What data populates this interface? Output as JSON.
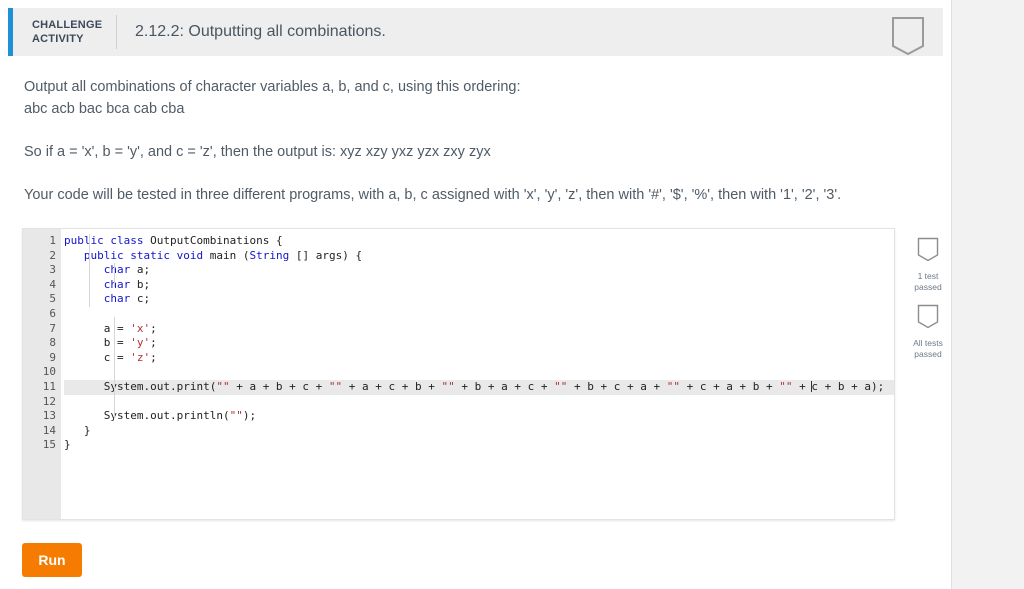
{
  "header": {
    "kicker_line1": "CHALLENGE",
    "kicker_line2": "ACTIVITY",
    "title": "2.12.2: Outputting all combinations.",
    "bookmark_icon": "shield-bookmark-icon"
  },
  "prompt": {
    "line1": "Output all combinations of character variables a, b, and c, using this ordering:",
    "line2": "abc acb bac bca cab cba",
    "line3": "So if a = 'x', b = 'y', and c = 'z', then the output is: xyz xzy yxz yzx zxy zyx",
    "line4": "Your code will be tested in three different programs, with a, b, c assigned with 'x', 'y', 'z', then with '#', '$', '%', then with '1', '2', '3'."
  },
  "editor": {
    "line_numbers": [
      "1",
      "2",
      "3",
      "4",
      "5",
      "6",
      "7",
      "8",
      "9",
      "10",
      "11",
      "12",
      "13",
      "14",
      "15"
    ],
    "lines": [
      "public class OutputCombinations {",
      "   public static void main (String [] args) {",
      "      char a;",
      "      char b;",
      "      char c;",
      "",
      "      a = 'x';",
      "      b = 'y';",
      "      c = 'z';",
      "",
      "      System.out.print(\"\" + a + b + c + \"\" + a + c + b + \"\" + b + a + c + \"\" + b + c + a + \"\" + c + a + b + \"\" + c + b + a);",
      "",
      "      System.out.println(\"\");",
      "   }",
      "}"
    ],
    "highlighted_line": 11,
    "cursor_line": 11
  },
  "tests": [
    {
      "icon": "shield-check-icon",
      "label_line1": "1 test",
      "label_line2": "passed"
    },
    {
      "icon": "shield-check-icon",
      "label_line1": "All tests",
      "label_line2": "passed"
    }
  ],
  "actions": {
    "run_label": "Run"
  },
  "colors": {
    "accent_blue": "#1f8fd6",
    "run_orange": "#f57c00",
    "header_bg": "#eeeeee",
    "gutter_bg": "#e8e8e8",
    "keyword": "#1414cf",
    "string": "#b03030"
  }
}
